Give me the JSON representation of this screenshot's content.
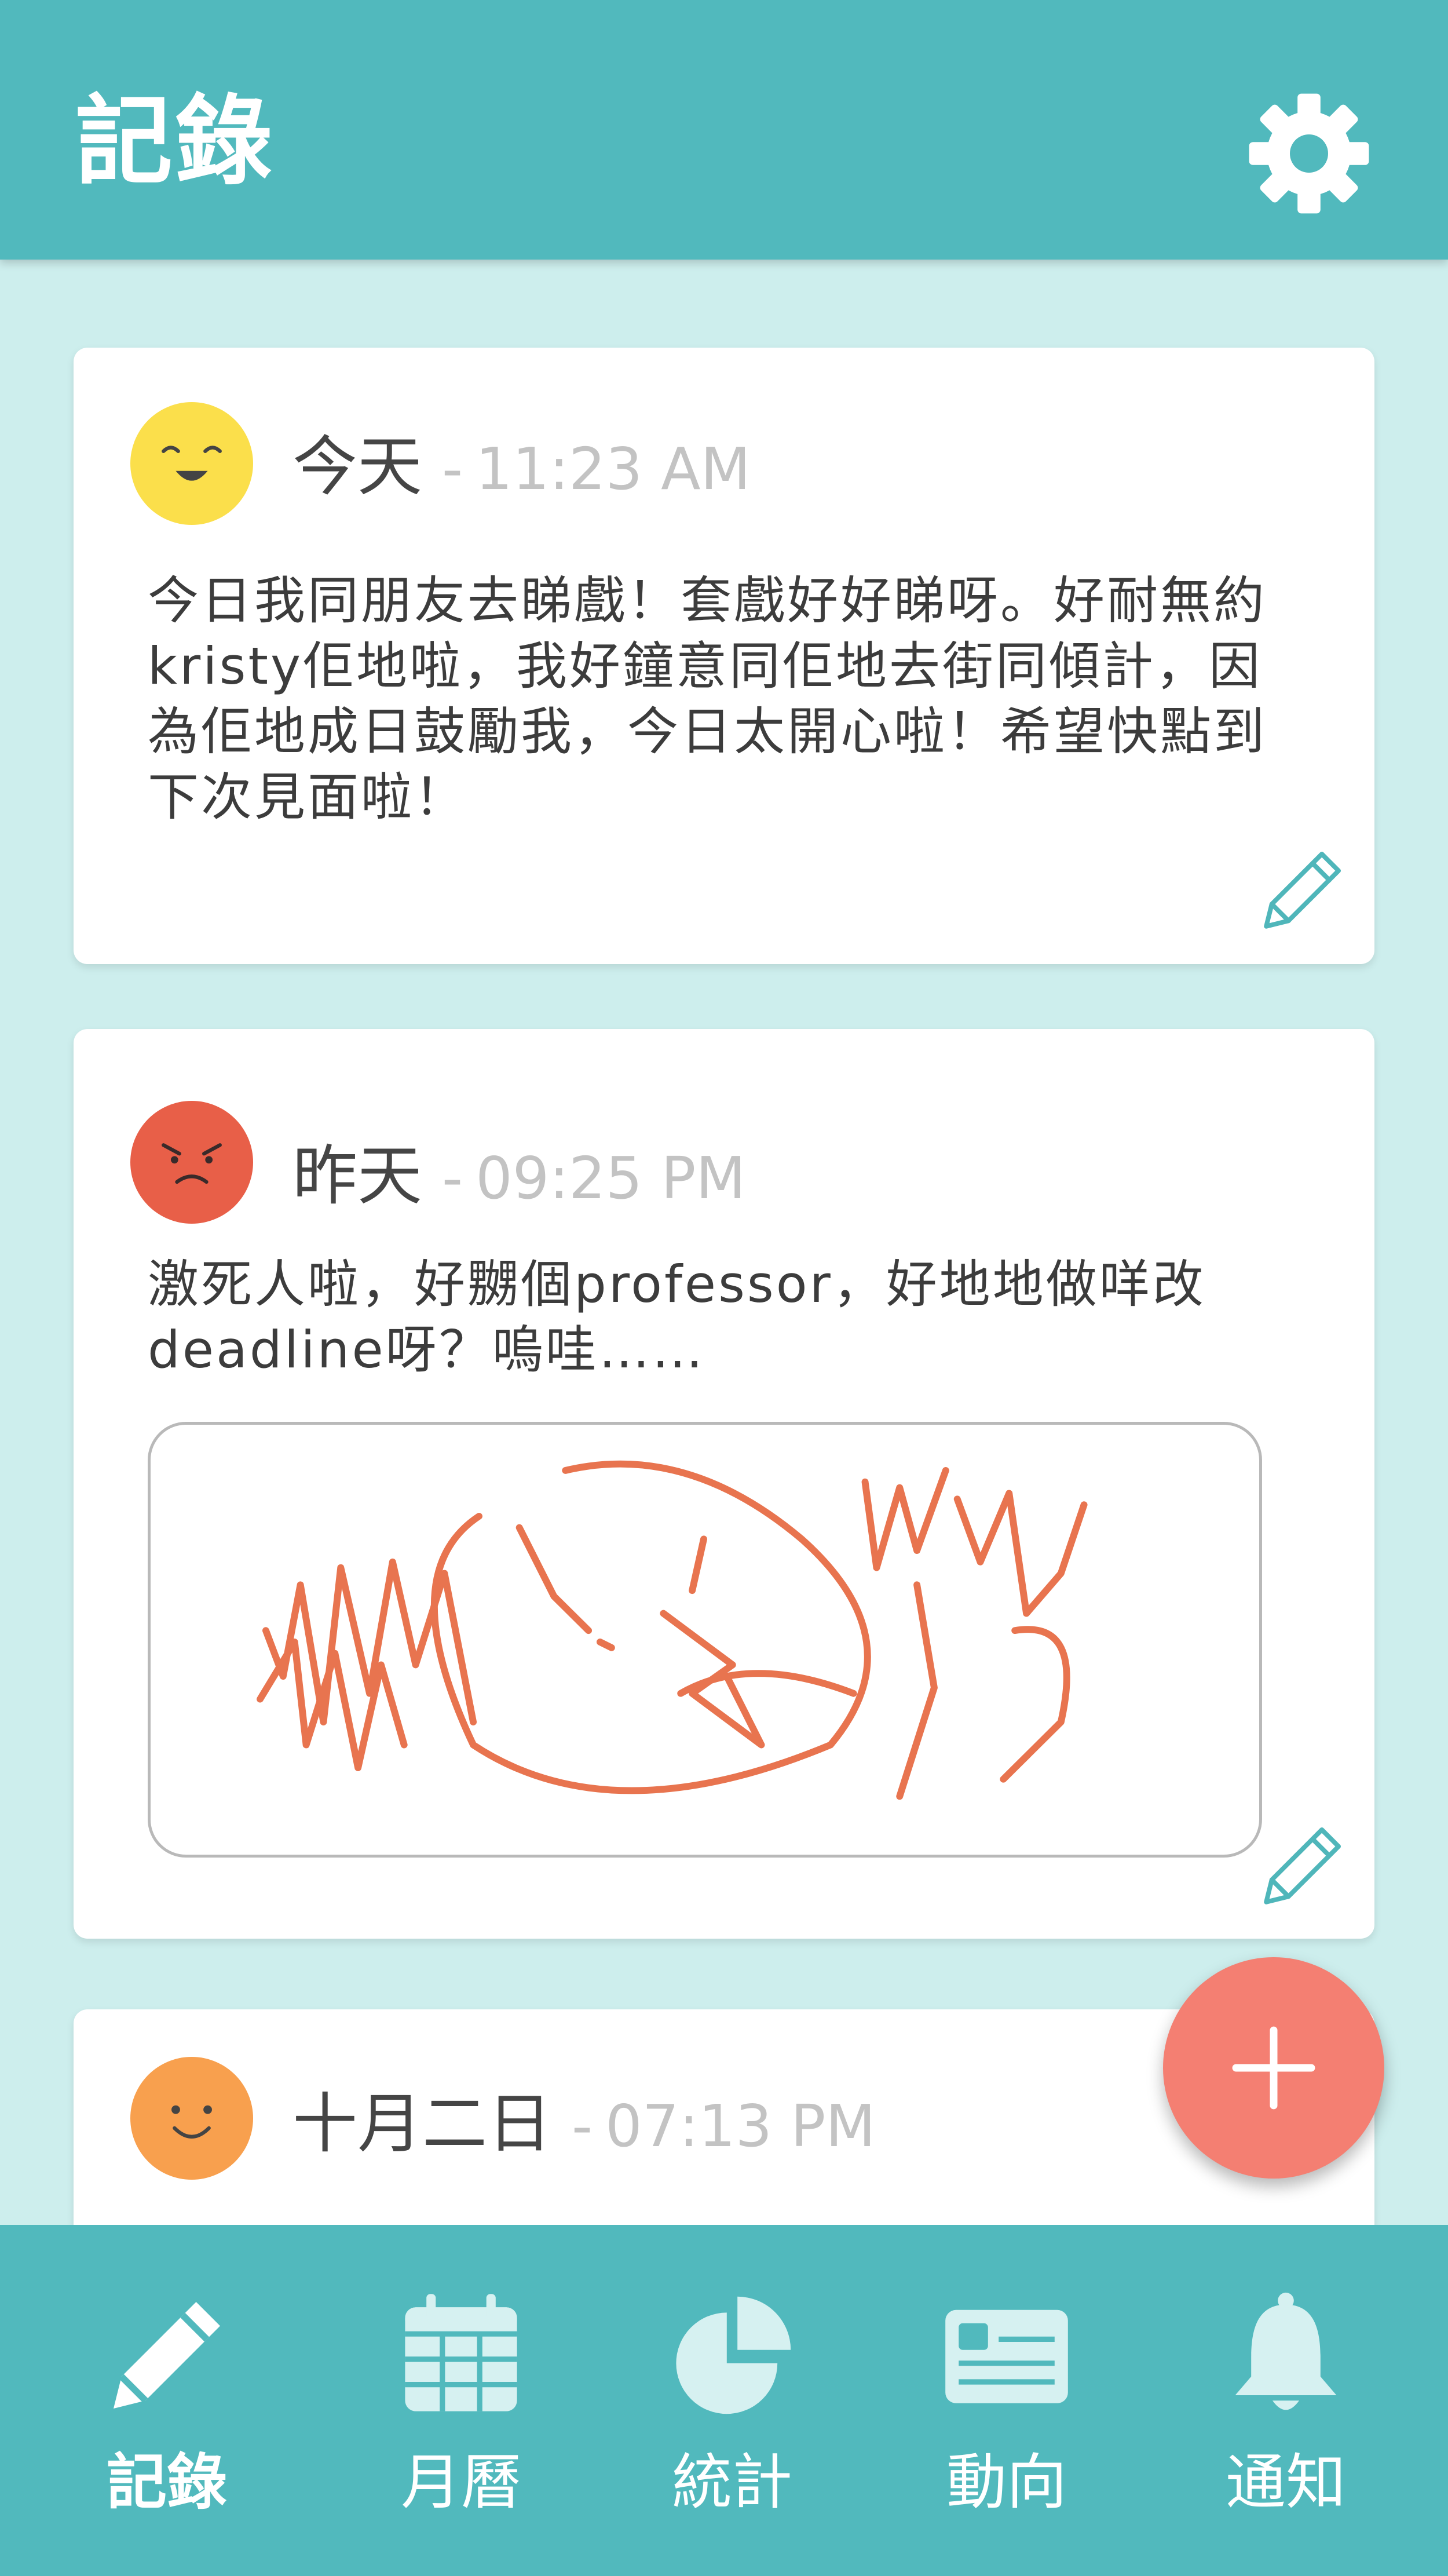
{
  "app_bar": {
    "title": "記錄",
    "settings_icon": "gear-icon"
  },
  "entries": [
    {
      "day": "今天",
      "separator": "-",
      "time": "11:23 AM",
      "mood_icon": "happy-face-icon",
      "mood_color": "#fbdf4b",
      "text": "今日我同朋友去睇戲！套戲好好睇呀。好耐無約kristy佢地啦，我好鐘意同佢地去街同傾計，因為佢地成日鼓勵我，今日太開心啦！希望快點到下次見面啦！",
      "edit_icon": "pencil-icon"
    },
    {
      "day": "昨天",
      "separator": "-",
      "time": "09:25 PM",
      "mood_icon": "angry-face-icon",
      "mood_color": "#e85f48",
      "text": "激死人啦，好嬲個professor，好地地做咩改deadline呀？嗚哇……",
      "has_drawing": true,
      "drawing_color": "#e8744f",
      "edit_icon": "pencil-icon"
    },
    {
      "day": "十月二日",
      "separator": "-",
      "time": "07:13 PM",
      "mood_icon": "smile-face-icon",
      "mood_color": "#f8a04e"
    }
  ],
  "fab": {
    "icon": "plus-icon",
    "color": "#f47f72"
  },
  "bottom_nav": [
    {
      "label": "記錄",
      "icon": "pencil-icon",
      "active": true
    },
    {
      "label": "月曆",
      "icon": "calendar-icon"
    },
    {
      "label": "統計",
      "icon": "pie-chart-icon"
    },
    {
      "label": "動向",
      "icon": "id-card-icon"
    },
    {
      "label": "通知",
      "icon": "bell-icon"
    }
  ],
  "colors": {
    "primary": "#51b9bd",
    "background": "#cdeeed",
    "icon_light": "#d6f1f1"
  }
}
